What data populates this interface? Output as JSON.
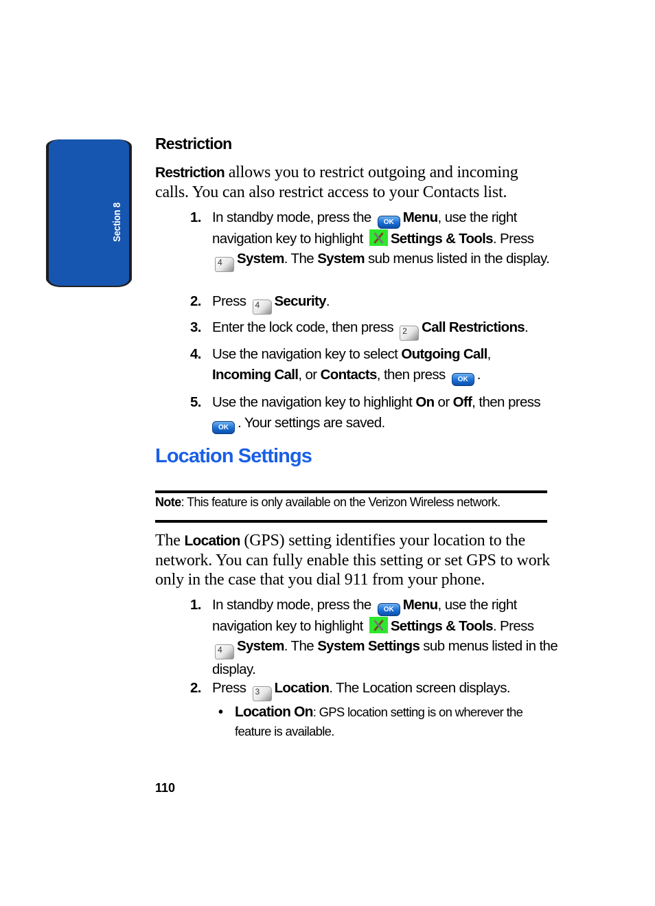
{
  "side_tab": {
    "label": "Section 8",
    "color": "#1756b0"
  },
  "restriction": {
    "heading": "Restriction",
    "intro_bold": "Restriction",
    "intro_rest": " allows you to restrict outgoing and incoming calls. You can also restrict access to your Contacts list.",
    "steps": [
      {
        "num": "1.",
        "t1": "In standby mode, press the ",
        "k1": "OK",
        "b1": "Menu",
        "t2": ", use the right navigation key to highlight ",
        "b2": "Settings & Tools",
        "t3": ". Press ",
        "k3": "4",
        "b3": "System",
        "t4": ". The ",
        "b4": "System",
        "t5": " sub menus listed in the display."
      },
      {
        "num": "2.",
        "t1": "Press ",
        "k1": "4",
        "b1": "Security",
        "t2": "."
      },
      {
        "num": "3.",
        "t1": "Enter the lock code, then press ",
        "k1": "2",
        "b1": "Call Restrictions",
        "t2": "."
      },
      {
        "num": "4.",
        "t1": "Use the navigation key to select ",
        "b1": "Outgoing Call",
        "t2": ", ",
        "b2": "Incoming Call",
        "t3": ", or ",
        "b3": "Contacts",
        "t4": ", then press ",
        "k4": "OK",
        "t5": "."
      },
      {
        "num": "5.",
        "t1": "Use the navigation key to highlight ",
        "b1": "On",
        "t2": " or ",
        "b2": "Off",
        "t3": ", then press ",
        "k3": "OK",
        "t4": ". Your settings are saved."
      }
    ]
  },
  "location": {
    "heading": "Location Settings",
    "heading_color": "#1a5fe6",
    "note_bold": "Note",
    "note_rest": ": This feature is only available on the Verizon Wireless network.",
    "intro_t1": "The ",
    "intro_bold": "Location",
    "intro_rest": " (GPS) setting identifies your location to the network. You can fully enable this setting or set GPS to work only in the case that you dial 911 from your phone.",
    "steps": [
      {
        "num": "1.",
        "t1": "In standby mode, press the ",
        "k1": "OK",
        "b1": "Menu",
        "t2": ", use the right navigation key to highlight ",
        "b2": "Settings & Tools",
        "t3": ". Press ",
        "k3": "4",
        "b3": "System",
        "t4": ". The ",
        "b4": "System Settings",
        "t5": " sub menus listed in the display."
      },
      {
        "num": "2.",
        "t1": "Press ",
        "k1": "3",
        "b1": "Location",
        "t2": ". The Location screen displays."
      }
    ],
    "bullets": [
      {
        "dot": "•",
        "bold": "Location On",
        "rest": ": GPS location setting is on wherever the feature is available."
      }
    ]
  },
  "page_number": "110"
}
